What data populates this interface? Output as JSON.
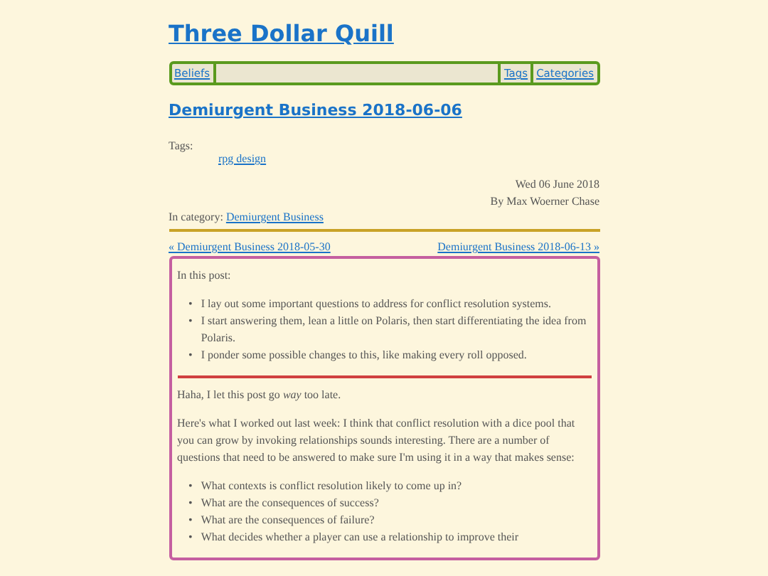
{
  "site_title": "Three Dollar Quill",
  "nav": {
    "left": [
      {
        "label": "Beliefs"
      }
    ],
    "right": [
      {
        "label": "Tags"
      },
      {
        "label": "Categories"
      }
    ]
  },
  "post": {
    "title": "Demiurgent Business 2018-06-06",
    "tags_label": "Tags:",
    "tags": [
      "rpg design"
    ],
    "date": "Wed 06 June 2018",
    "author": "By Max Woerner Chase",
    "category_label": "In category:",
    "category": "Demiurgent Business"
  },
  "pager": {
    "prev": "« Demiurgent Business 2018-05-30",
    "next": "Demiurgent Business 2018-06-13 »"
  },
  "summary": {
    "intro": "In this post:",
    "items": [
      "I lay out some important questions to address for conflict resolution systems.",
      "I start answering them, lean a little on Polaris, then start differentiating the idea from Polaris.",
      "I ponder some possible changes to this, like making every roll opposed."
    ]
  },
  "bullet": "•",
  "paragraphs": [
    "Haha, I let this post go *way* too late.",
    "Here's what I worked out last week: I think that conflict resolution with a dice pool that you can grow by invoking relationships sounds interesting. There are a number of questions that need to be answered to make sure I'm using it in a way that makes sense:"
  ],
  "questions": [
    "What contexts is conflict resolution likely to come up in?",
    "What are the consequences of success?",
    "What are the consequences of failure?",
    "What decides whether a player can use a relationship to improve their"
  ]
}
